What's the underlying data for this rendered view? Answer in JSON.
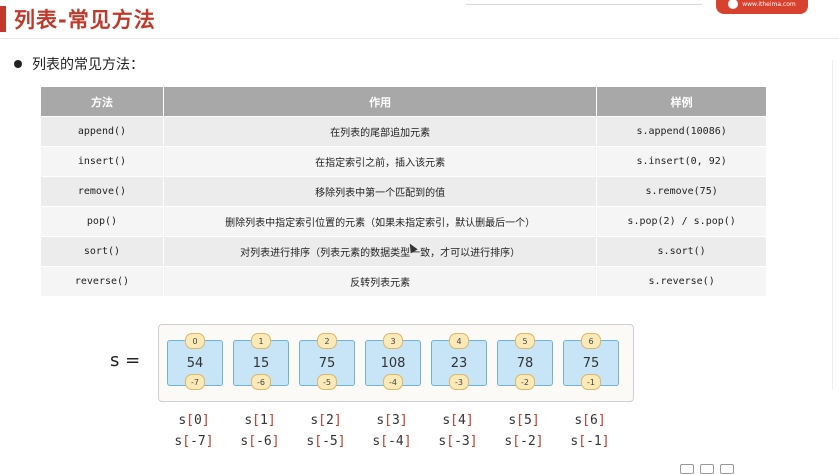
{
  "header": {
    "title": "列表-常见方法",
    "logo_text": "www.itheima.com"
  },
  "bullet": "列表的常见方法：",
  "table": {
    "headers": [
      "方法",
      "作用",
      "样例"
    ],
    "rows": [
      {
        "method": "append()",
        "desc": "在列表的尾部追加元素",
        "example": "s.append(10086)"
      },
      {
        "method": "insert()",
        "desc": "在指定索引之前，插入该元素",
        "example": "s.insert(0, 92)"
      },
      {
        "method": "remove()",
        "desc": "移除列表中第一个匹配到的值",
        "example": "s.remove(75)"
      },
      {
        "method": "pop()",
        "desc": "删除列表中指定索引位置的元素（如果未指定索引，默认删最后一个）",
        "example": "s.pop(2) / s.pop()"
      },
      {
        "method": "sort()",
        "desc": "对列表进行排序（列表元素的数据类型一致，才可以进行排序）",
        "example": "s.sort()"
      },
      {
        "method": "reverse()",
        "desc": "反转列表元素",
        "example": "s.reverse()"
      }
    ]
  },
  "diagram": {
    "var_label": "s  =",
    "values": [
      "54",
      "15",
      "75",
      "108",
      "23",
      "78",
      "75"
    ],
    "pos_index": [
      "0",
      "1",
      "2",
      "3",
      "4",
      "5",
      "6"
    ],
    "neg_index": [
      "-7",
      "-6",
      "-5",
      "-4",
      "-3",
      "-2",
      "-1"
    ],
    "pos_access": [
      "0",
      "1",
      "2",
      "3",
      "4",
      "5",
      "6"
    ],
    "neg_access": [
      "-7",
      "-6",
      "-5",
      "-4",
      "-3",
      "-2",
      "-1"
    ],
    "var_name": "s"
  },
  "colors": {
    "accent": "#c0392b",
    "header_bg": "#a8a8a8",
    "cell_bg": "#c7e5f6",
    "index_bg": "#fbe9b7"
  }
}
